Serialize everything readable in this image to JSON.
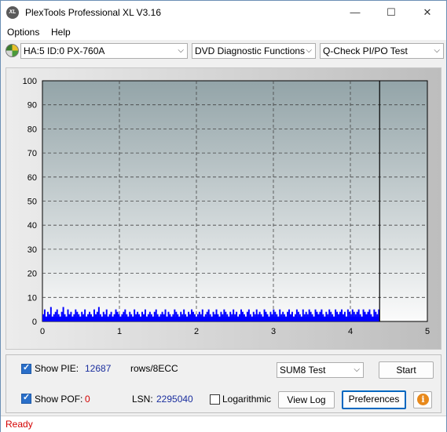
{
  "window": {
    "app_icon_text": "XL",
    "title": "PlexTools Professional XL V3.16",
    "minimize_glyph": "—",
    "maximize_glyph": "☐",
    "close_glyph": "✕"
  },
  "menu": {
    "options": "Options",
    "help": "Help"
  },
  "toolbar": {
    "drive": "HA:5 ID:0  PX-760A",
    "function": "DVD Diagnostic Functions",
    "test": "Q-Check PI/PO Test",
    "dropdown_glyph": "⌵"
  },
  "chart_data": {
    "type": "bar",
    "x_ticks": [
      "0",
      "1",
      "2",
      "3",
      "4",
      "5"
    ],
    "y_ticks": [
      "0",
      "10",
      "20",
      "30",
      "40",
      "50",
      "60",
      "70",
      "80",
      "90",
      "100"
    ],
    "xlim": [
      0,
      5
    ],
    "ylim": [
      0,
      100
    ],
    "grid": true,
    "end_marker_x": 4.38,
    "series": [
      {
        "color": "#0000ff",
        "x_end": 4.38,
        "values": [
          3,
          5,
          2,
          4,
          3,
          6,
          2,
          3,
          4,
          5,
          3,
          2,
          4,
          6,
          3,
          2,
          5,
          3,
          4,
          2,
          3,
          5,
          4,
          3,
          2,
          4,
          3,
          5,
          2,
          3,
          4,
          3,
          2,
          5,
          3,
          4,
          6,
          3,
          2,
          4,
          3,
          5,
          2,
          3,
          4,
          2,
          3,
          5,
          4,
          3,
          2,
          3,
          4,
          5,
          3,
          2,
          4,
          3,
          2,
          5,
          3,
          4,
          3,
          2,
          4,
          3,
          5,
          2,
          3,
          4,
          3,
          2,
          4,
          5,
          3,
          2,
          3,
          4,
          3,
          5,
          2,
          4,
          3,
          2,
          3,
          5,
          4,
          3,
          2,
          4,
          3,
          5,
          3,
          2,
          4,
          3,
          5,
          4,
          3,
          2,
          3,
          4,
          3,
          5,
          2,
          3,
          4,
          5,
          3,
          2,
          4,
          3,
          5,
          3,
          2,
          4,
          3,
          5,
          4,
          3,
          2,
          4,
          3,
          5,
          3,
          4,
          2,
          3,
          5,
          4,
          3,
          2,
          4,
          5,
          3,
          2,
          4,
          3,
          5,
          3,
          4,
          3,
          2,
          5,
          4,
          3,
          2,
          4,
          3,
          5,
          4,
          3,
          2,
          5,
          3,
          4,
          3,
          2,
          4,
          5,
          3,
          4,
          2,
          3,
          5,
          4,
          3,
          2,
          5,
          3,
          4,
          3,
          5,
          4,
          3,
          2,
          5,
          4,
          3,
          4,
          5,
          3,
          2,
          4,
          3,
          5,
          4,
          3,
          2,
          5,
          4,
          3,
          4,
          5,
          3,
          4,
          2,
          5,
          4,
          3,
          5,
          4,
          3,
          4,
          5,
          3,
          2,
          5,
          4,
          3,
          4,
          5,
          3,
          2,
          5,
          4,
          3,
          5
        ]
      }
    ]
  },
  "controls": {
    "show_pie_label": "Show PIE:",
    "pie_count": "12687",
    "rows_unit": "rows/8ECC",
    "show_pof_label": "Show POF:",
    "pof_count": "0",
    "lsn_label": "LSN:",
    "lsn_value": "2295040",
    "logarithmic_label": "Logarithmic",
    "test_select": "SUM8 Test",
    "start_button": "Start",
    "view_log_button": "View Log",
    "preferences_button": "Preferences",
    "info_glyph": "i",
    "show_pie_checked": true,
    "show_pof_checked": true,
    "logarithmic_checked": false
  },
  "status": {
    "text": "Ready"
  }
}
